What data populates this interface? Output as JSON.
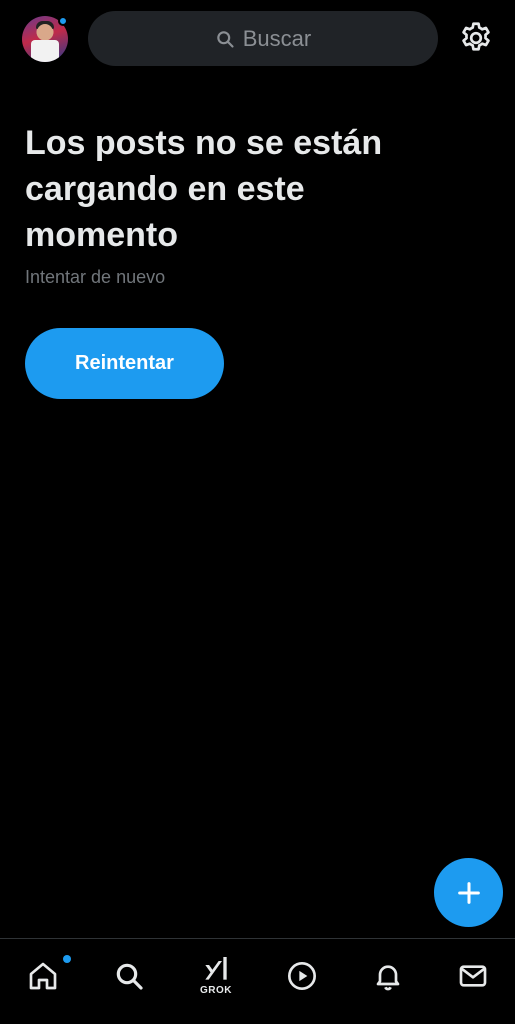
{
  "header": {
    "avatar_alt": "Perfil",
    "search_placeholder": "Buscar",
    "settings_icon": "gear-icon"
  },
  "error": {
    "title": "Los posts no se están cargando en este momento",
    "subtitle": "Intentar de nuevo",
    "retry_label": "Reintentar"
  },
  "fab": {
    "icon": "plus-icon"
  },
  "bottom_nav": {
    "items": [
      {
        "icon": "home-icon"
      },
      {
        "icon": "search-icon"
      },
      {
        "icon": "grok-icon",
        "label": "GROK"
      },
      {
        "icon": "play-circle-icon"
      },
      {
        "icon": "bell-icon"
      },
      {
        "icon": "mail-icon"
      }
    ]
  },
  "colors": {
    "accent": "#1d9bf0",
    "background": "#000000",
    "search_bg": "#202327",
    "muted": "#71767b"
  }
}
